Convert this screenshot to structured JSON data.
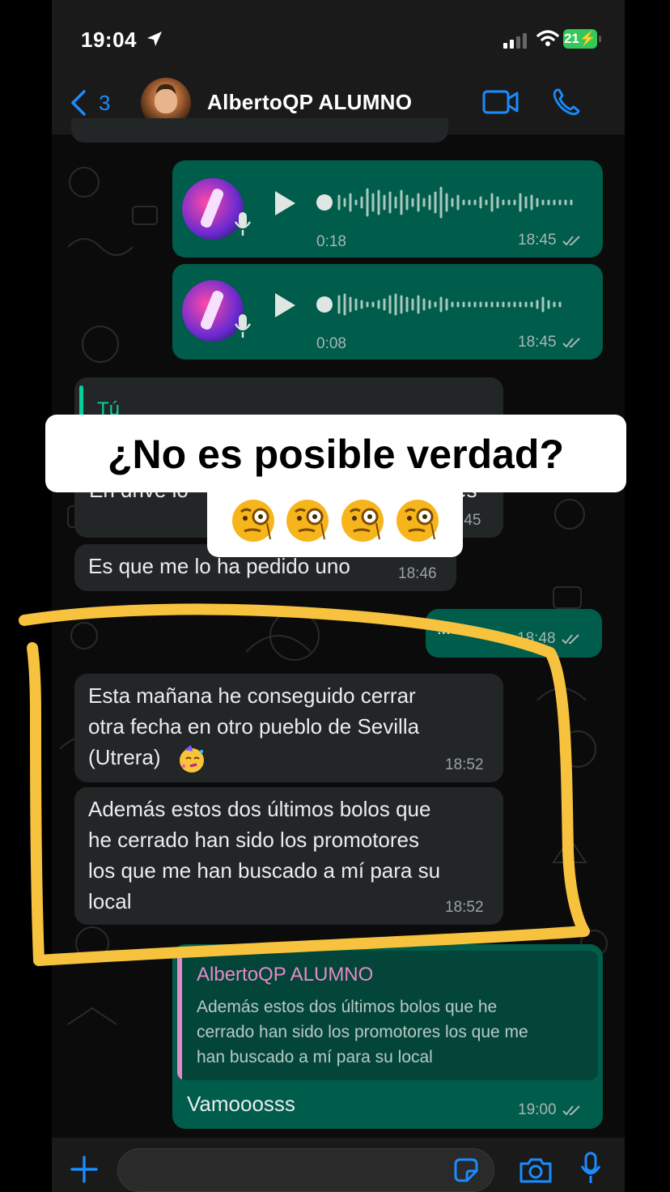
{
  "status_bar": {
    "time": "19:04",
    "battery": "21"
  },
  "header": {
    "back_count": "3",
    "contact_name": "AlbertoQP  ALUMNO"
  },
  "voice_notes": [
    {
      "duration": "0:18",
      "time": "18:45"
    },
    {
      "duration": "0:08",
      "time": "18:45"
    }
  ],
  "quoted_in": {
    "author": "Tú",
    "partial_text": "En drive lo",
    "partial_text_end": "es",
    "time": ":45"
  },
  "messages": [
    {
      "id": "pedido",
      "direction": "in",
      "text": "Es que me lo ha pedido uno",
      "time": "18:46"
    },
    {
      "id": "sent-hidden",
      "direction": "out",
      "text": "...en",
      "time": "18:48"
    },
    {
      "id": "utrera",
      "direction": "in",
      "lines": [
        "Esta mañana he conseguido cerrar",
        "otra fecha en otro pueblo de Sevilla",
        "(Utrera)"
      ],
      "emoji": "party-face",
      "time": "18:52"
    },
    {
      "id": "promotores",
      "direction": "in",
      "lines": [
        "Además estos dos últimos bolos que",
        "he cerrado han sido los promotores",
        "los que me han buscado a mí para su",
        "local"
      ],
      "time": "18:52"
    }
  ],
  "reply": {
    "quoted_author": "AlbertoQP  ALUMNO",
    "quoted_lines": [
      "Además estos dos últimos bolos que he",
      "cerrado han sido los promotores los que me",
      "han buscado a mí para su local"
    ],
    "text": "Vamooosss",
    "time": "19:00"
  },
  "overlay": {
    "title": "¿No es posible verdad?",
    "emojis": [
      "face-with-monocle",
      "face-with-monocle",
      "face-with-monocle",
      "face-with-monocle"
    ]
  },
  "colors": {
    "accent": "#1a8cff",
    "outgoing": "#005c4b",
    "incoming": "#232626",
    "highlight": "#f7c23e",
    "quote_name": "#e58ac8"
  }
}
